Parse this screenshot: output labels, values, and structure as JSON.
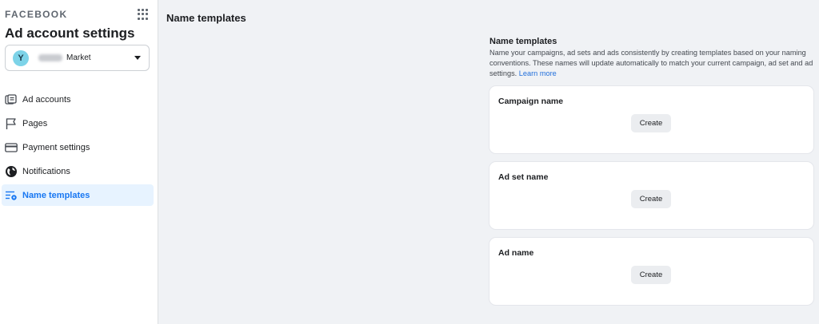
{
  "sidebar": {
    "brand": "FACEBOOK",
    "title": "Ad account settings",
    "account": {
      "initial": "Y",
      "name": "Market",
      "avatar_color": "#7dd3e8"
    },
    "items": [
      {
        "label": "Ad accounts",
        "icon": "ad-accounts-icon",
        "active": false
      },
      {
        "label": "Pages",
        "icon": "flag-icon",
        "active": false
      },
      {
        "label": "Payment settings",
        "icon": "credit-card-icon",
        "active": false
      },
      {
        "label": "Notifications",
        "icon": "globe-icon",
        "active": false
      },
      {
        "label": "Name templates",
        "icon": "name-templates-icon",
        "active": true
      }
    ]
  },
  "main": {
    "title": "Name templates",
    "intro": {
      "heading": "Name templates",
      "description": "Name your campaigns, ad sets and ads consistently by creating templates based on your naming conventions. These names will update automatically to match your current campaign, ad set and ad settings.",
      "link": "Learn more"
    },
    "cards": [
      {
        "title": "Campaign name",
        "button": "Create"
      },
      {
        "title": "Ad set name",
        "button": "Create"
      },
      {
        "title": "Ad name",
        "button": "Create"
      }
    ]
  },
  "colors": {
    "accent": "#1877f2",
    "active_bg": "#e7f3ff",
    "page_bg": "#f0f2f5"
  }
}
